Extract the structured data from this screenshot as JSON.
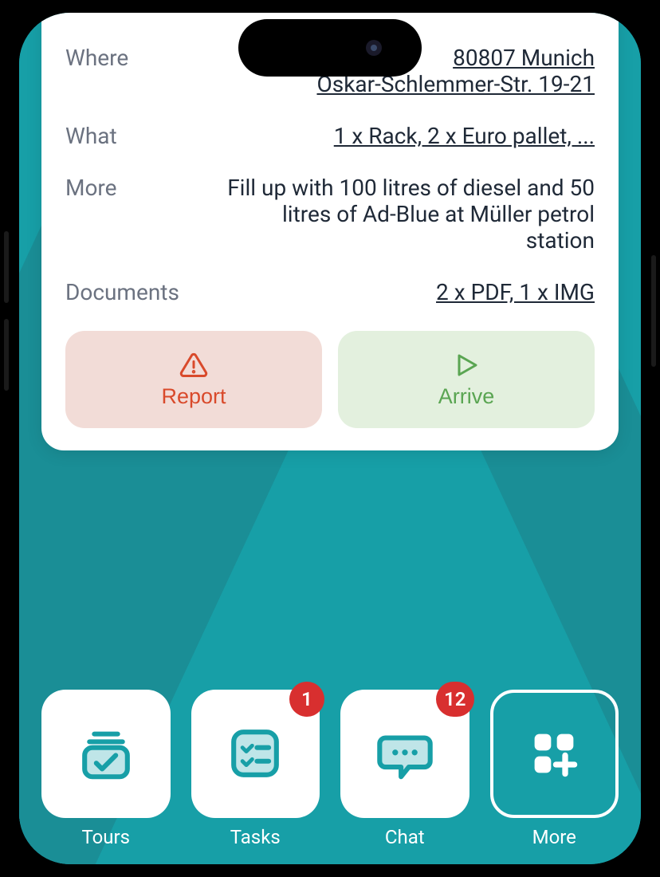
{
  "details": {
    "where_label": "Where",
    "where_line1": "80807 Munich",
    "where_line2": "Oskar-Schlemmer-Str. 19-21",
    "what_label": "What",
    "what_value": "1 x Rack, 2 x Euro pallet, ...",
    "more_label": "More",
    "more_value": "Fill up with 100 litres of diesel and 50 litres of Ad-Blue at Müller petrol station",
    "documents_label": "Documents",
    "documents_value": "2 x PDF, 1 x IMG"
  },
  "buttons": {
    "report": "Report",
    "arrive": "Arrive"
  },
  "tabs": {
    "tours": "Tours",
    "tasks": "Tasks",
    "tasks_badge": "1",
    "chat": "Chat",
    "chat_badge": "12",
    "more": "More"
  },
  "colors": {
    "teal": "#179fa7",
    "report": "#d94a2b",
    "arrive": "#5aa552"
  }
}
